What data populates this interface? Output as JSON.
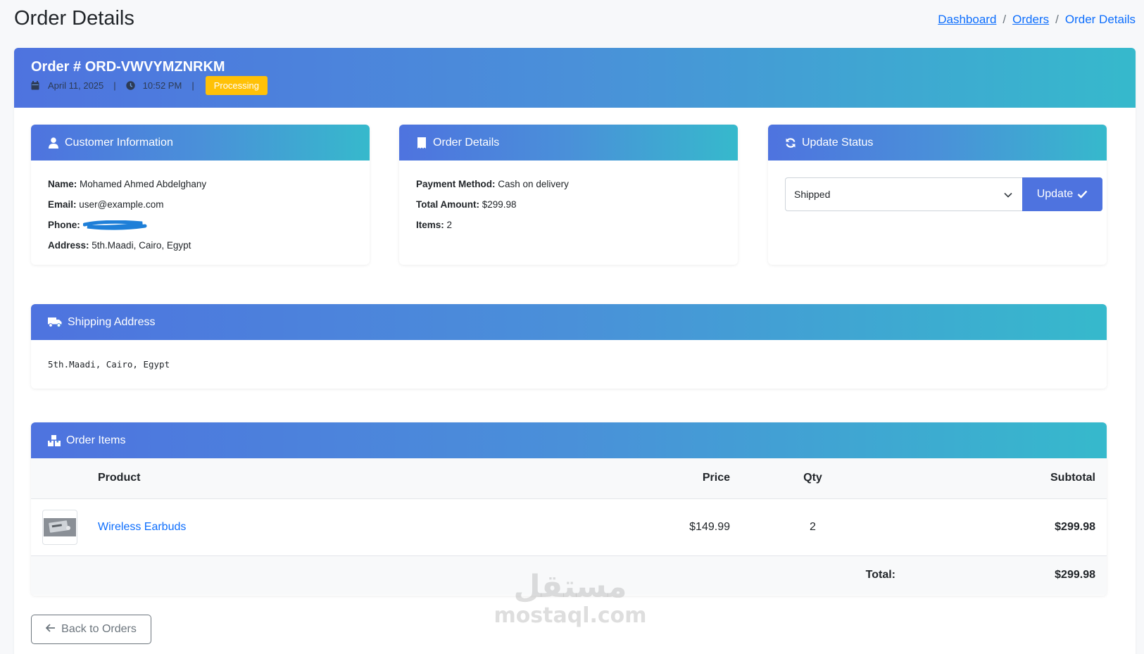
{
  "page": {
    "title": "Order Details"
  },
  "breadcrumb": {
    "items": [
      "Dashboard",
      "Orders"
    ],
    "separator": "/",
    "current": "Order Details"
  },
  "order": {
    "number": "Order # ORD-VWVYMZNRKM",
    "date": "April 11, 2025",
    "time": "10:52 PM",
    "meta_divider": "|",
    "status": "Processing"
  },
  "customer": {
    "header": "Customer Information",
    "name_label": "Name:",
    "name": "Mohamed Ahmed Abdelghany",
    "email_label": "Email:",
    "email": "user@example.com",
    "phone_label": "Phone:",
    "address_label": "Address:",
    "address": "5th.Maadi, Cairo, Egypt"
  },
  "order_details": {
    "header": "Order Details",
    "payment_label": "Payment Method:",
    "payment": "Cash on delivery",
    "total_label": "Total Amount:",
    "total": "$299.98",
    "items_label": "Items:",
    "items": "2"
  },
  "update_status": {
    "header": "Update Status",
    "selected": "Shipped",
    "button": "Update"
  },
  "shipping": {
    "header": "Shipping Address",
    "address": "5th.Maadi, Cairo, Egypt"
  },
  "order_items": {
    "header": "Order Items",
    "columns": {
      "product": "Product",
      "price": "Price",
      "qty": "Qty",
      "subtotal": "Subtotal"
    },
    "rows": [
      {
        "product": "Wireless Earbuds",
        "price": "$149.99",
        "qty": "2",
        "subtotal": "$299.98"
      }
    ],
    "total_label": "Total:",
    "total": "$299.98"
  },
  "back_button": "Back to Orders",
  "watermark": {
    "arabic": "مستقل",
    "latin": "mostaql.com"
  },
  "colors": {
    "gradient_start": "#4e73df",
    "gradient_end": "#36b9cc",
    "status_badge": "#ffc107",
    "link": "#0d6efd",
    "button": "#4e73df"
  },
  "icons": [
    "calendar-icon",
    "clock-icon",
    "user-icon",
    "receipt-icon",
    "sync-icon",
    "check-icon",
    "chevron-down-icon",
    "truck-icon",
    "boxes-icon",
    "arrow-left-icon"
  ]
}
